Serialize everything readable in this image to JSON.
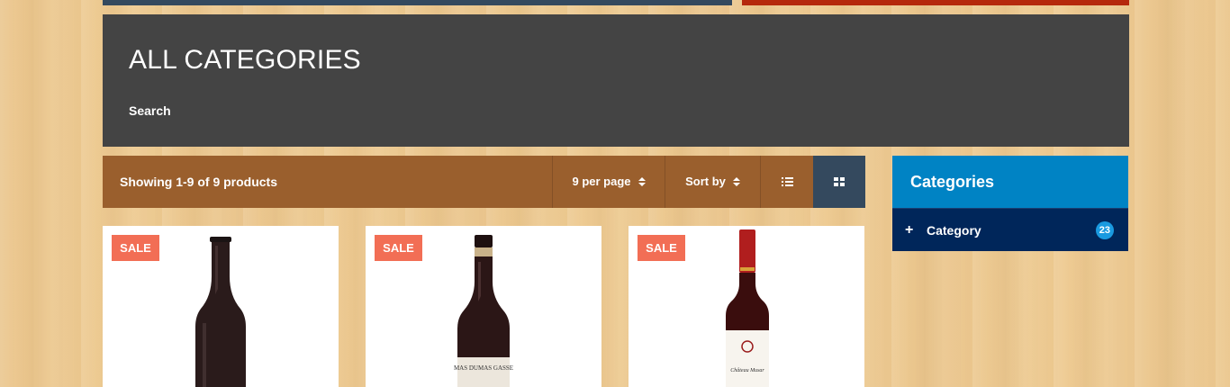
{
  "hero": {
    "title": "ALL CATEGORIES",
    "breadcrumb": "Search"
  },
  "toolbar": {
    "showing": "Showing 1-9 of 9 products",
    "per_page": "9 per page",
    "sort_by": "Sort by",
    "view_list_icon": "list-view-icon",
    "view_grid_icon": "grid-view-icon",
    "active_view": "grid"
  },
  "sidebar": {
    "title": "Categories",
    "items": [
      {
        "label": "Category",
        "count": "23",
        "icon": "plus-icon"
      }
    ]
  },
  "products": [
    {
      "badge": "SALE",
      "bottle_label": ""
    },
    {
      "badge": "SALE",
      "bottle_label": "MAS DUMAS GASSE"
    },
    {
      "badge": "SALE",
      "bottle_label": "Château Musar"
    }
  ],
  "colors": {
    "background": "#eecb93",
    "hero_bg": "#444444",
    "toolbar_bg": "#9a5f2d",
    "active_view_bg": "#34495e",
    "sidebar_head": "#0083c4",
    "sidebar_item": "#00265a",
    "badge": "#1a9ae0",
    "sale": "#f26e55",
    "top_bar_left": "#34495e",
    "top_bar_right": "#b5280c"
  }
}
